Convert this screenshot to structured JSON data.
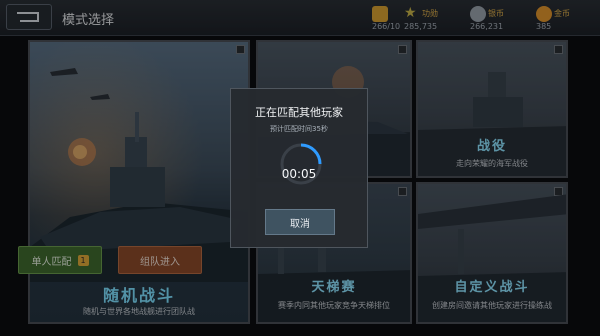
{
  "header": {
    "title": "模式选择",
    "resources": [
      {
        "label": "",
        "value": "266/10",
        "color": "#d9a232",
        "icon": "fuel-icon"
      },
      {
        "label": "功勋",
        "value": "285,735",
        "color": "#c9b54a",
        "icon": "star-icon"
      },
      {
        "label": "银币",
        "value": "266,231",
        "color": "#9aa3ad",
        "icon": "silver-coin-icon"
      },
      {
        "label": "金币",
        "value": "385",
        "color": "#e0952d",
        "icon": "gold-coin-icon"
      }
    ]
  },
  "cards": {
    "random": {
      "title": "随机战斗",
      "desc": "随机与世界各地战舰进行团队战"
    },
    "campaign": {
      "title": "战役",
      "desc": "走向荣耀的海军战役"
    },
    "ladder": {
      "title": "天梯赛",
      "desc": "赛季内同其他玩家竞争天梯排位"
    },
    "custom": {
      "title": "自定义战斗",
      "desc": "创建房间邀请其他玩家进行操练战"
    }
  },
  "buttons": {
    "solo": "单人匹配",
    "solo_badge": "1",
    "team": "组队进入"
  },
  "dialog": {
    "title": "正在匹配其他玩家",
    "subtitle": "预计匹配时间35秒",
    "timer": "00:05",
    "cancel": "取消"
  },
  "colors": {
    "accent_cyan": "#7fe0ff",
    "solo_green": "#3f6a2f",
    "team_orange": "#8c4a2a"
  }
}
